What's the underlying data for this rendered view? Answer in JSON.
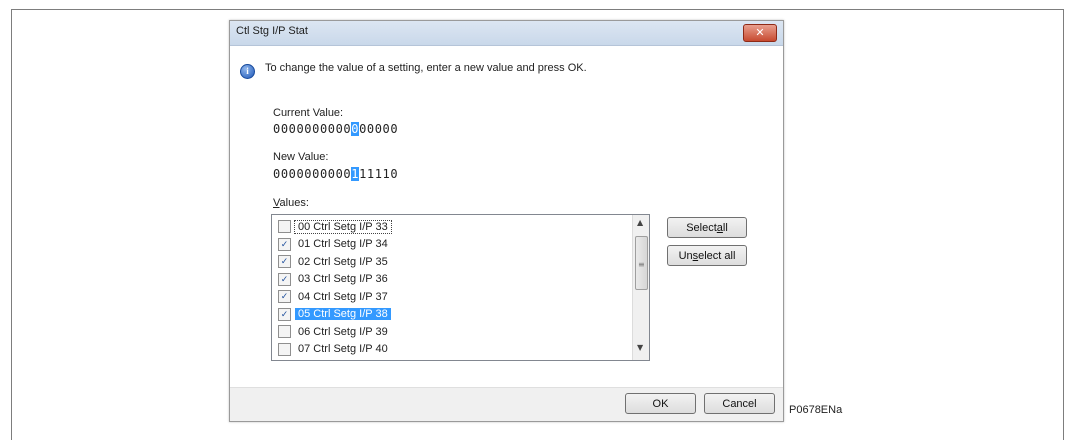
{
  "dialog": {
    "title": "Ctl Stg I/P Stat",
    "close_glyph": "✕",
    "message": "To change the value of a setting, enter a new value and press OK.",
    "current_value_label": "Current Value:",
    "current_value": {
      "before": "0000000000",
      "highlight": "0",
      "after": "00000"
    },
    "new_value_label": "New Value:",
    "new_value": {
      "before": "0000000000",
      "highlight": "1",
      "after": "11110"
    },
    "values_label_prefix": "",
    "values_label_mnemonic": "V",
    "values_label_rest": "alues:",
    "items": [
      {
        "label": "00 Ctrl Setg I/P 33",
        "checked": false,
        "focused": true,
        "selected": false
      },
      {
        "label": "01 Ctrl Setg I/P 34",
        "checked": true,
        "focused": false,
        "selected": false
      },
      {
        "label": "02 Ctrl Setg I/P 35",
        "checked": true,
        "focused": false,
        "selected": false
      },
      {
        "label": "03 Ctrl Setg I/P 36",
        "checked": true,
        "focused": false,
        "selected": false
      },
      {
        "label": "04 Ctrl Setg I/P 37",
        "checked": true,
        "focused": false,
        "selected": false
      },
      {
        "label": "05 Ctrl Setg I/P 38",
        "checked": true,
        "focused": false,
        "selected": true
      },
      {
        "label": "06 Ctrl Setg I/P 39",
        "checked": false,
        "focused": false,
        "selected": false
      },
      {
        "label": "07 Ctrl Setg I/P 40",
        "checked": false,
        "focused": false,
        "selected": false
      }
    ],
    "select_all_prefix": "Select ",
    "select_all_mnemonic": "a",
    "select_all_rest": "ll",
    "unselect_all_prefix": "Un",
    "unselect_all_mnemonic": "s",
    "unselect_all_rest": "elect all",
    "ok_label": "OK",
    "cancel_label": "Cancel"
  },
  "figure_id": "P0678ENa",
  "colors": {
    "highlight": "#3399ff",
    "title_bar": "#c9d8ea",
    "close_button": "#c74a30",
    "footer": "#f0f0f0"
  },
  "icons": [
    "info-icon",
    "close-icon",
    "checkbox-icon",
    "scroll-up-icon",
    "scroll-down-icon",
    "grip-icon"
  ]
}
